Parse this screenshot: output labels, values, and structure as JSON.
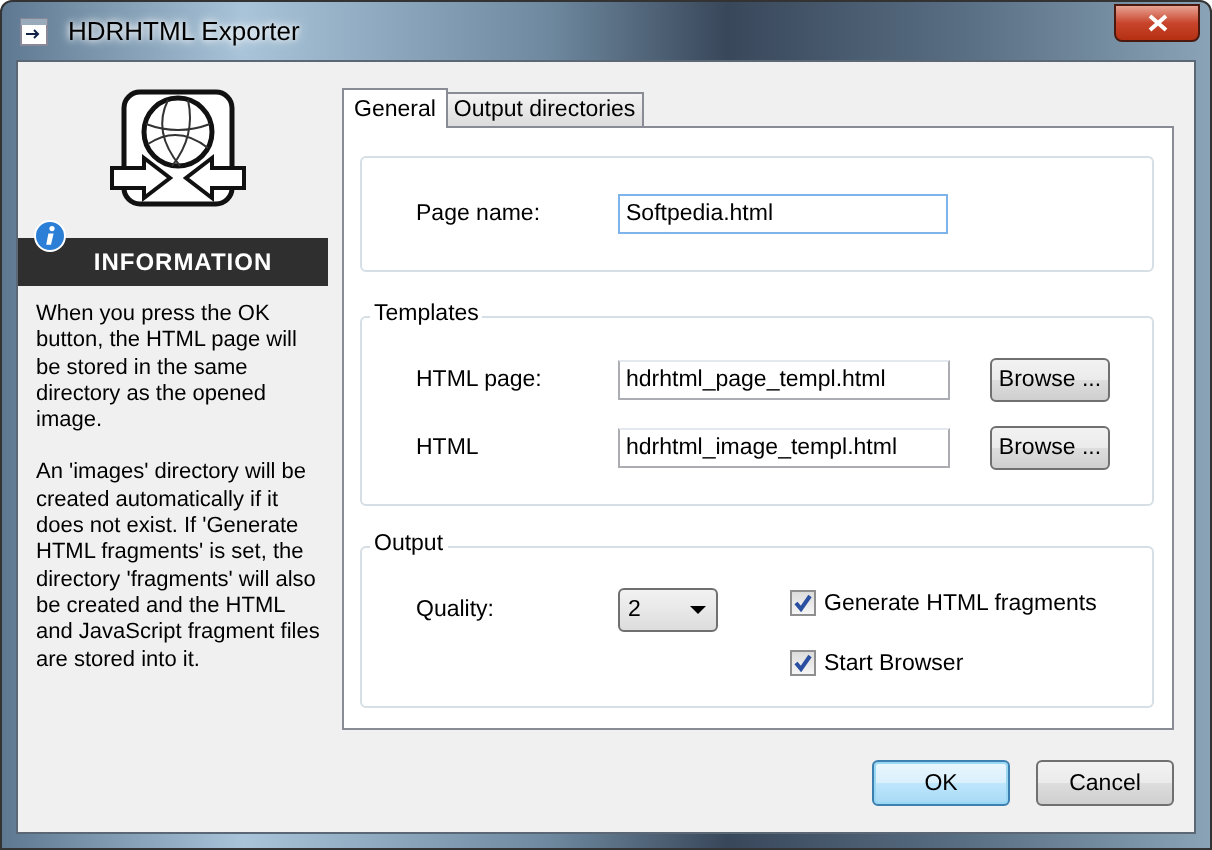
{
  "window": {
    "title": "HDRHTML Exporter"
  },
  "sidebar": {
    "heading": "INFORMATION",
    "paragraphs": [
      "When you press the OK button, the HTML page will be stored in the same directory as the opened image.",
      "An 'images' directory will be created automatically if it does not exist. If 'Generate HTML fragments' is set, the directory 'fragments' will also be created and the HTML and JavaScript fragment files are stored into it."
    ]
  },
  "tabs": [
    {
      "label": "General",
      "selected": true
    },
    {
      "label": "Output directories",
      "selected": false
    }
  ],
  "page_name": {
    "label": "Page name:",
    "value": "Softpedia.html"
  },
  "templates": {
    "title": "Templates",
    "rows": [
      {
        "label": "HTML page:",
        "value": "hdrhtml_page_templ.html",
        "button": "Browse ..."
      },
      {
        "label": "HTML",
        "value": "hdrhtml_image_templ.html",
        "button": "Browse ..."
      }
    ]
  },
  "output": {
    "title": "Output",
    "quality": {
      "label": "Quality:",
      "value": "2"
    },
    "checkboxes": [
      {
        "label": "Generate HTML fragments",
        "checked": true
      },
      {
        "label": "Start Browser",
        "checked": true
      }
    ]
  },
  "buttons": [
    {
      "label": "OK",
      "default": true
    },
    {
      "label": "Cancel",
      "default": false
    }
  ]
}
